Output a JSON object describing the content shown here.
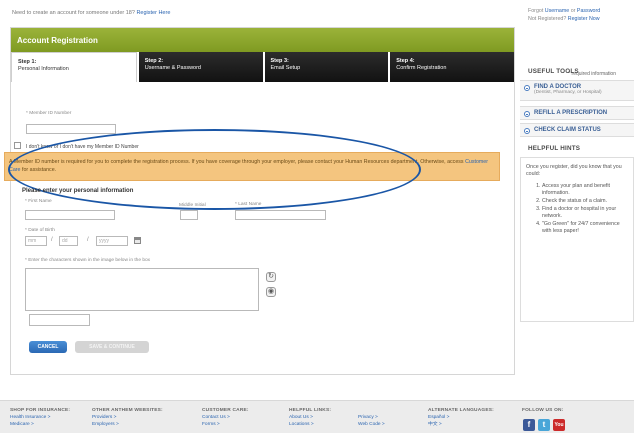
{
  "top_note": {
    "text": "Need to create an account for someone under 18?",
    "link": "Register Here"
  },
  "registration": {
    "header": "Account Registration",
    "steps": [
      {
        "num": "Step 1:",
        "label": "Personal Information"
      },
      {
        "num": "Step 2:",
        "label": "Username & Password"
      },
      {
        "num": "Step 3:",
        "label": "Email Setup"
      },
      {
        "num": "Step 4:",
        "label": "Confirm Registration"
      }
    ],
    "required_info": "* required information",
    "member_id_label": "* Member ID Number",
    "member_id_value": "",
    "dont_know_label": "I don't know or I don't have my Member ID Number",
    "alert_text": "A Member ID number is required for you to complete the registration process. If you have coverage through your employer, please contact your Human Resources department. Otherwise, access",
    "alert_link": "Customer Care",
    "alert_tail": "for assistance.",
    "personal_info_title": "Please enter your personal information",
    "first_name_label": "* First Name",
    "middle_initial_label": "Middle Initial",
    "last_name_label": "* Last Name",
    "dob_label": "* Date of Birth",
    "dob_mm_placeholder": "mm",
    "dob_dd_placeholder": "dd",
    "dob_yyyy_placeholder": "yyyy",
    "captcha_label": "* Enter the characters shown in the image below in the box",
    "captcha_value": "",
    "cancel_label": "CANCEL",
    "save_label": "SAVE & CONTINUE"
  },
  "sidebar": {
    "forgot_prefix": "Forgot",
    "forgot_username": "Username",
    "or": "or",
    "forgot_password": "Password",
    "not_registered": "Not Registered?",
    "register_now": "Register Now",
    "useful_tools_title": "USEFUL TOOLS",
    "tools": [
      {
        "label": "FIND A DOCTOR",
        "sub": "(Dentist, Pharmacy, or Hospital)"
      },
      {
        "label": "REFILL A PRESCRIPTION",
        "sub": ""
      },
      {
        "label": "CHECK CLAIM STATUS",
        "sub": ""
      }
    ],
    "helpful_hints_title": "HELPFUL HINTS",
    "hints_intro": "Once you register, did you know that you could:",
    "hints": [
      "Access your plan and benefit information.",
      "Check the status of a claim.",
      "Find a doctor or hospital in your network.",
      "\"Go Green\" for 24/7 convenience with less paper!"
    ]
  },
  "footer": {
    "columns": [
      {
        "heading": "SHOP FOR INSURANCE:",
        "links": [
          "Health Insurance >",
          "Medicare >"
        ]
      },
      {
        "heading": "OTHER ANTHEM WEBSITES:",
        "links": [
          "Providers >",
          "Employers >"
        ]
      },
      {
        "heading": "CUSTOMER CARE:",
        "links": [
          "Contact Us >",
          "Forms >"
        ]
      },
      {
        "heading": "HELPFUL LINKS:",
        "links": [
          "About Us >",
          "Locations >"
        ]
      },
      {
        "heading": "",
        "links": [
          "Privacy >",
          "Web Code >"
        ]
      },
      {
        "heading": "ALTERNATE LANGUAGES:",
        "links": [
          "Español >",
          "中文 >"
        ]
      },
      {
        "heading": "FOLLOW US ON:",
        "links": []
      }
    ],
    "social_icons": [
      "facebook-icon",
      "twitter-icon",
      "youtube-icon"
    ],
    "youtube_text": "You"
  }
}
